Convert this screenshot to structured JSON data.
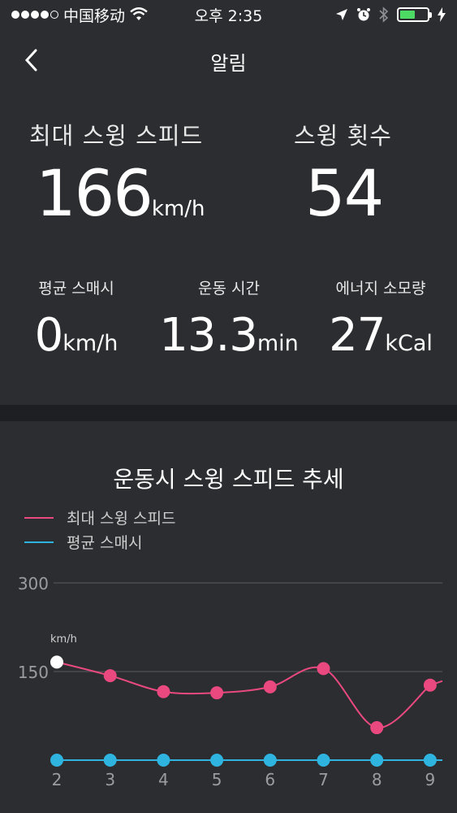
{
  "status_bar": {
    "carrier": "中国移动",
    "time": "오후 2:35"
  },
  "nav": {
    "title": "알림"
  },
  "stats": {
    "max_swing_speed": {
      "label": "최대 스윙 스피드",
      "value": "166",
      "unit": "km/h"
    },
    "swing_count": {
      "label": "스윙 횟수",
      "value": "54"
    },
    "avg_smash": {
      "label": "평균 스매시",
      "value": "0",
      "unit": "km/h"
    },
    "exercise_time": {
      "label": "운동 시간",
      "value": "13.3",
      "unit": "min"
    },
    "energy": {
      "label": "에너지 소모량",
      "value": "27",
      "unit": "kCal"
    }
  },
  "colors": {
    "background": "#2b2d31",
    "max_series": "#e9497e",
    "avg_series": "#2fb4e0",
    "battery": "#4cd964"
  },
  "chart_data": {
    "type": "line",
    "title": "운동시 스윙 스피드 추세",
    "x": [
      2,
      3,
      4,
      5,
      6,
      7,
      8,
      9
    ],
    "x_tick_labels": [
      "2",
      "3",
      "4",
      "5",
      "6",
      "7",
      "8",
      "9"
    ],
    "y_ticks": [
      300,
      150
    ],
    "ylim": [
      0,
      300
    ],
    "annotation": "km/h",
    "series": [
      {
        "name": "최대 스윙 스피드",
        "color": "#e9497e",
        "values": [
          166,
          143,
          116,
          114,
          124,
          155,
          55,
          127
        ]
      },
      {
        "name": "평균 스매시",
        "color": "#2fb4e0",
        "values": [
          0,
          0,
          0,
          0,
          0,
          0,
          0,
          0
        ]
      }
    ],
    "grid": true,
    "legend": "top-left"
  }
}
